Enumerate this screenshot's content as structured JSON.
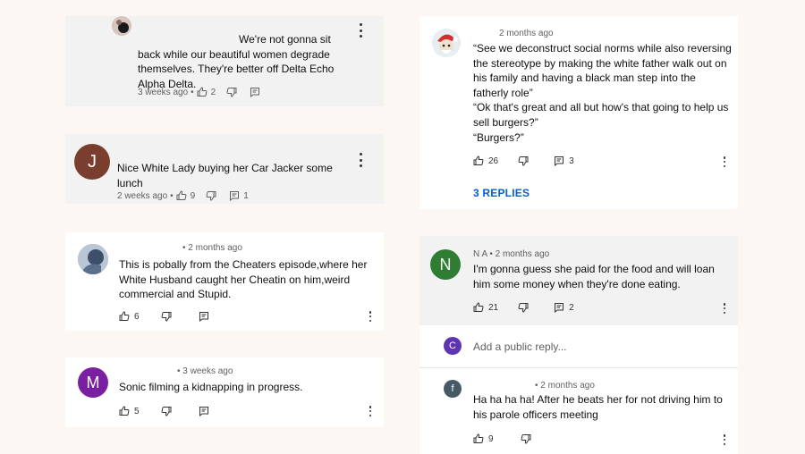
{
  "colors": {
    "link": "#065fd4",
    "avatar_j": "#7a3e2e",
    "avatar_m": "#7b1fa2",
    "avatar_n": "#2e7d32",
    "avatar_c": "#5e35b1",
    "avatar_f": "#455a64"
  },
  "c1": {
    "text": "We're not gonna sit back while our beautiful women degrade themselves. They're better off Delta Echo Alpha Delta.",
    "line1": "We're not gonna sit",
    "line2": "back while our beautiful women degrade",
    "line3": "themselves. They're better off Delta Echo",
    "line4": "Alpha Delta.",
    "time": "3 weeks ago",
    "likes": "2"
  },
  "c2": {
    "avatar_letter": "J",
    "line1": "Nice White Lady buying her Car Jacker some",
    "line2": "lunch",
    "time": "2 weeks ago",
    "likes": "9",
    "replies": "1"
  },
  "c3": {
    "time": "• 2 months ago",
    "line1": "This is pobally from the Cheaters episode,where her",
    "line2": "White Husband caught her Cheatin on him,weird",
    "line3": "commercial and Stupid.",
    "likes": "6"
  },
  "c4": {
    "avatar_letter": "M",
    "time": "• 3 weeks ago",
    "line1": "Sonic filming a kidnapping in progress.",
    "likes": "5"
  },
  "c5": {
    "time": "2 months ago",
    "line1": "“See we deconstruct social norms while also reversing",
    "line2": "the stereotype by making the white father walk out on",
    "line3": "his family and having a black man step into the",
    "line4": "fatherly role”",
    "line5": "“Ok that's great and all but how's that going to help us",
    "line6": "sell burgers?”",
    "line7": "“Burgers?”",
    "likes": "26",
    "replies": "3",
    "replies_link": "3 REPLIES"
  },
  "c6": {
    "avatar_letter": "N",
    "meta": "N A • 2 months ago",
    "line1": "I'm gonna guess she paid for the food and will loan",
    "line2": "him some money when they're done eating.",
    "likes": "21",
    "replies": "2"
  },
  "reply_box": {
    "avatar_letter": "C",
    "placeholder": "Add a public reply..."
  },
  "c7": {
    "avatar_letter": "f",
    "time": "• 2 months ago",
    "line1": "Ha ha ha ha! After he beats her for not driving him to",
    "line2": "his parole officers meeting",
    "likes": "9"
  }
}
